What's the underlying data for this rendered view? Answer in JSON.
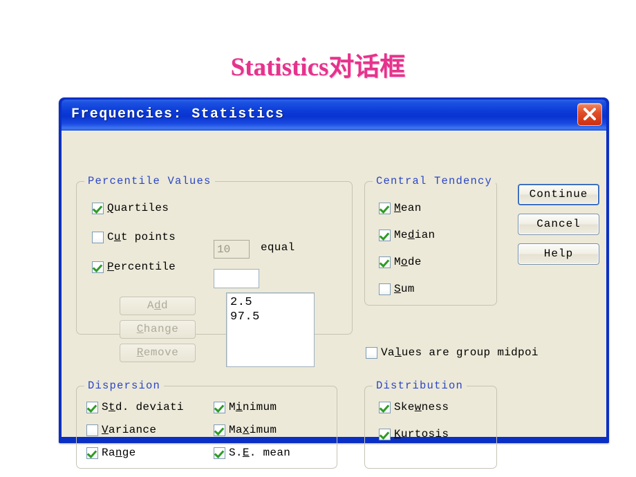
{
  "slide": {
    "title": "Statistics对话框",
    "title_color": "#E5338C"
  },
  "dialog": {
    "title": "Frequencies: Statistics",
    "titlebar_color": "#0A3BD8",
    "body_color": "#ECE9D8",
    "close_icon": "close-icon"
  },
  "percentile_values": {
    "legend": "Percentile Values",
    "quartiles": {
      "label_pre": "",
      "mnemonic": "Q",
      "label_post": "uartiles",
      "checked": true
    },
    "cut_points": {
      "label_pre": "C",
      "mnemonic": "u",
      "label_post": "t points",
      "checked": false
    },
    "cut_points_field": {
      "value": "10",
      "disabled": true
    },
    "equal_label": "equal",
    "percentile": {
      "label_pre": "",
      "mnemonic": "P",
      "label_post": "ercentile",
      "checked": true
    },
    "percentile_field": {
      "value": "",
      "placeholder": ""
    },
    "buttons": [
      {
        "label_pre": "A",
        "mnemonic": "d",
        "label_post": "d",
        "disabled": true
      },
      {
        "label_pre": "",
        "mnemonic": "C",
        "label_post": "hange",
        "disabled": true
      },
      {
        "label_pre": "",
        "mnemonic": "R",
        "label_post": "emove",
        "disabled": true
      }
    ],
    "list_items": [
      "2.5",
      "97.5"
    ]
  },
  "central_tendency": {
    "legend": "Central Tendency",
    "items": [
      {
        "label_pre": "",
        "mnemonic": "M",
        "label_post": "ean",
        "checked": true
      },
      {
        "label_pre": "Me",
        "mnemonic": "d",
        "label_post": "ian",
        "checked": true
      },
      {
        "label_pre": "M",
        "mnemonic": "o",
        "label_post": "de",
        "checked": true
      },
      {
        "label_pre": "",
        "mnemonic": "S",
        "label_post": "um",
        "checked": false
      }
    ]
  },
  "values_midpoints": {
    "label_pre": "Va",
    "mnemonic": "l",
    "label_post": "ues are group midpoi",
    "checked": false
  },
  "dispersion": {
    "legend": "Dispersion",
    "left_items": [
      {
        "label_pre": "S",
        "mnemonic": "t",
        "label_post": "d. deviati",
        "checked": true
      },
      {
        "label_pre": "",
        "mnemonic": "V",
        "label_post": "ariance",
        "checked": false
      },
      {
        "label_pre": "Ra",
        "mnemonic": "n",
        "label_post": "ge",
        "checked": true
      }
    ],
    "right_items": [
      {
        "label_pre": "M",
        "mnemonic": "i",
        "label_post": "nimum",
        "checked": true
      },
      {
        "label_pre": "Ma",
        "mnemonic": "x",
        "label_post": "imum",
        "checked": true
      },
      {
        "label_pre": "S.",
        "mnemonic": "E",
        "label_post": ". mean",
        "checked": true
      }
    ]
  },
  "distribution": {
    "legend": "Distribution",
    "items": [
      {
        "label_pre": "Ske",
        "mnemonic": "w",
        "label_post": "ness",
        "checked": true
      },
      {
        "label_pre": "",
        "mnemonic": "K",
        "label_post": "urtosis",
        "checked": true
      }
    ]
  },
  "actions": {
    "continue": "Continue",
    "cancel": "Cancel",
    "help": "Help"
  }
}
